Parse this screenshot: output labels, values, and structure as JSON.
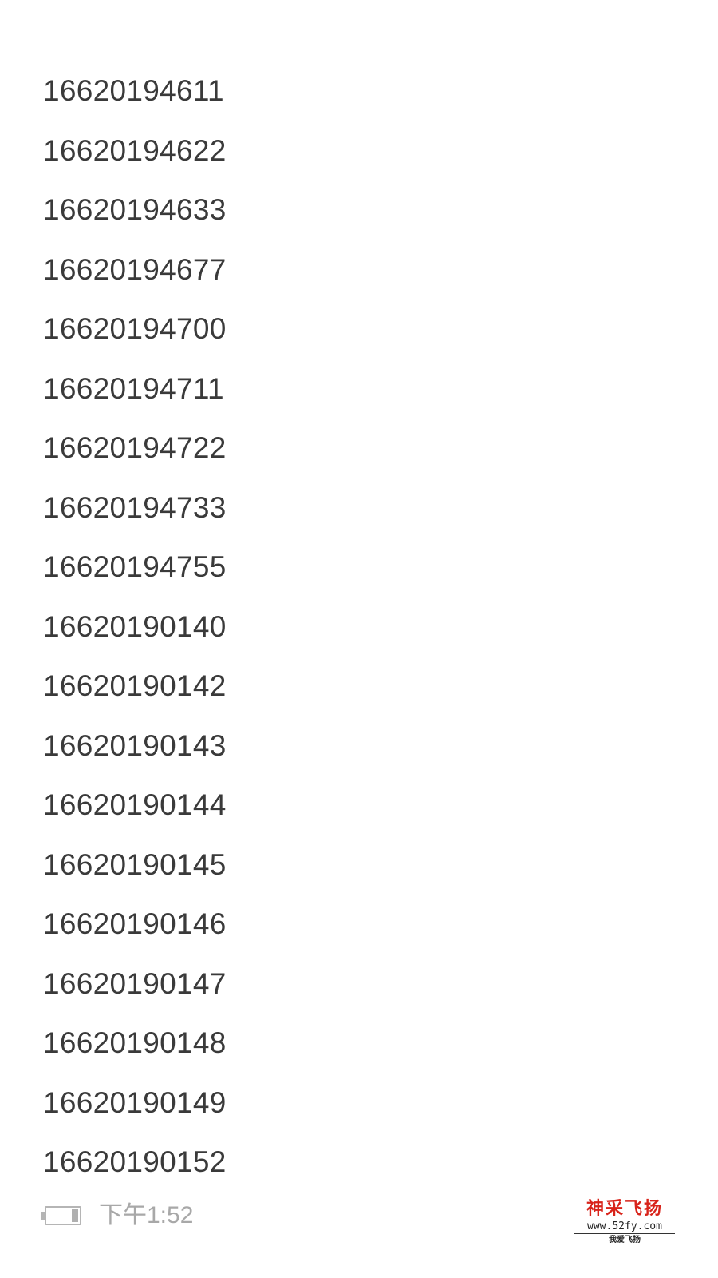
{
  "numbers": [
    "16620194611",
    "16620194622",
    "16620194633",
    "16620194677",
    "16620194700",
    "16620194711",
    "16620194722",
    "16620194733",
    "16620194755",
    "16620190140",
    "16620190142",
    "16620190143",
    "16620190144",
    "16620190145",
    "16620190146",
    "16620190147",
    "16620190148",
    "16620190149",
    "16620190152"
  ],
  "status_bar": {
    "time": "下午1:52",
    "battery_level": 0.2
  },
  "watermark": {
    "title": "神采飞扬",
    "url": "www.52fy.com",
    "subtitle": "我爱飞扬"
  }
}
